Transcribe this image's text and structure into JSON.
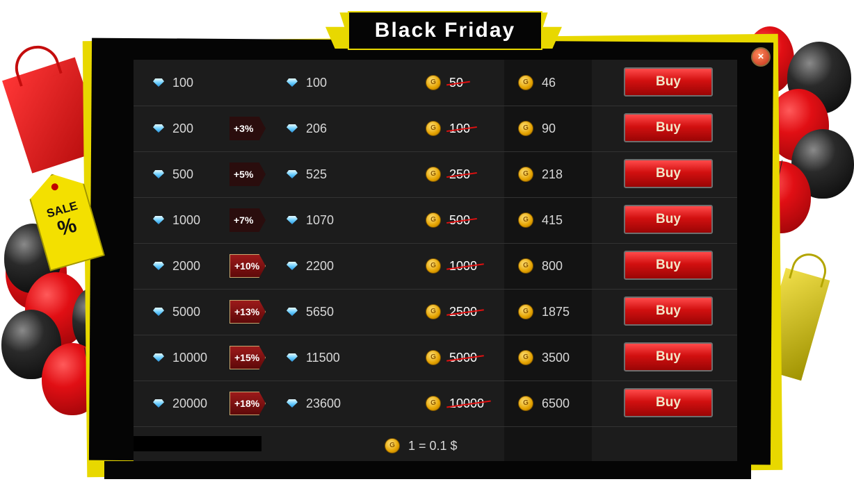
{
  "title": "Black Friday",
  "sale_tag": {
    "word": "SALE",
    "symbol": "%"
  },
  "close_icon": "×",
  "buy_label": "Buy",
  "coin_letter": "G",
  "rows": [
    {
      "base": "100",
      "bonus": "",
      "total": "100",
      "old_price": "50",
      "price": "46"
    },
    {
      "base": "200",
      "bonus": "+3%",
      "total": "206",
      "old_price": "100",
      "price": "90"
    },
    {
      "base": "500",
      "bonus": "+5%",
      "total": "525",
      "old_price": "250",
      "price": "218"
    },
    {
      "base": "1000",
      "bonus": "+7%",
      "total": "1070",
      "old_price": "500",
      "price": "415"
    },
    {
      "base": "2000",
      "bonus": "+10%",
      "total": "2200",
      "old_price": "1000",
      "price": "800"
    },
    {
      "base": "5000",
      "bonus": "+13%",
      "total": "5650",
      "old_price": "2500",
      "price": "1875"
    },
    {
      "base": "10000",
      "bonus": "+15%",
      "total": "11500",
      "old_price": "5000",
      "price": "3500"
    },
    {
      "base": "20000",
      "bonus": "+18%",
      "total": "23600",
      "old_price": "10000",
      "price": "6500"
    }
  ],
  "exchange_rate": "1 = 0.1 $",
  "colors": {
    "frame_yellow": "#e8d800",
    "buy_red": "#d21010",
    "strike_red": "#e01010"
  }
}
